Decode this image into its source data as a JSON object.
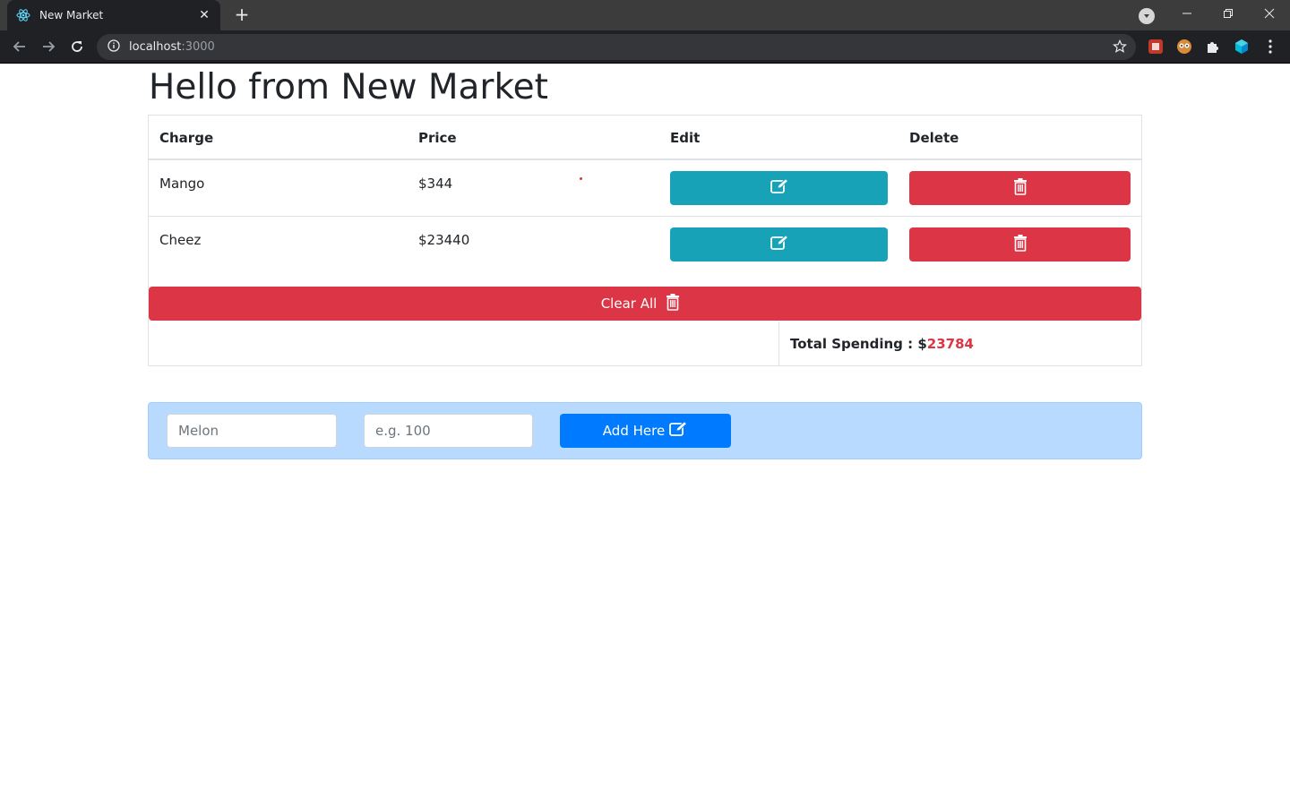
{
  "browser": {
    "tab_title": "New Market",
    "url_host": "localhost",
    "url_port": ":3000"
  },
  "page": {
    "heading": "Hello from New Market"
  },
  "table": {
    "headers": [
      "Charge",
      "Price",
      "Edit",
      "Delete"
    ],
    "rows": [
      {
        "charge": "Mango",
        "price": "$344"
      },
      {
        "charge": "Cheez",
        "price": "$23440"
      }
    ]
  },
  "actions": {
    "clear_all_label": "Clear All",
    "add_label": "Add Here"
  },
  "total": {
    "label": "Total Spending : $",
    "value": "23784"
  },
  "form": {
    "charge_placeholder": "Melon",
    "price_placeholder": "e.g. 100"
  },
  "colors": {
    "info": "#17a2b8",
    "danger": "#dc3545",
    "primary": "#007bff",
    "form_bg": "#b8daff"
  }
}
